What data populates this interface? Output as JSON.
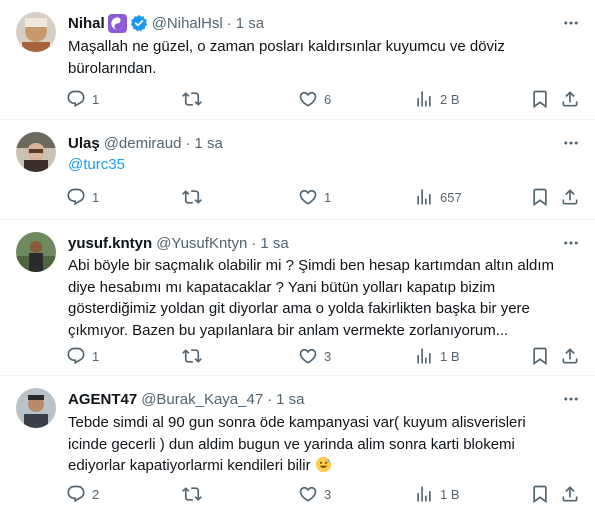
{
  "tweets": [
    {
      "name": "Nihal",
      "handle": "@NihalHsl",
      "sep": "·",
      "time": "1 sa",
      "text": "Maşallah ne güzel, o zaman posları kaldırsınlar kuyumcu ve döviz\nbürolarından.",
      "replies": "1",
      "retweets": "",
      "likes": "6",
      "views": "2 B",
      "badges": [
        "yin-yang-icon",
        "verified-badge-icon"
      ]
    },
    {
      "name": "Ulaş",
      "handle": "@demiraud",
      "sep": "·",
      "time": "1 sa",
      "text": "@turc35",
      "replies": "1",
      "retweets": "",
      "likes": "1",
      "views": "657",
      "badges": []
    },
    {
      "name": "yusuf.kntyn",
      "handle": "@YusufKntyn",
      "sep": "·",
      "time": "1 sa",
      "text": "Abi böyle bir saçmalık olabilir mi ? Şimdi ben hesap kartımdan altın aldım\ndiye hesabımı mı kapatacaklar ? Yani bütün yolları kapatıp bizim\ngösterdiğimiz yoldan git diyorlar ama o yolda fakirlikten başka bir yere\nçıkmıyor. Bazen bu yapılanlara bir anlam vermekte zorlanıyorum...",
      "replies": "1",
      "retweets": "",
      "likes": "3",
      "views": "1 B",
      "badges": []
    },
    {
      "name": "AGENT47",
      "handle": "@Burak_Kaya_47",
      "sep": "·",
      "time": "1 sa",
      "text": "Tebde simdi al 90 gun sonra öde kampanyasi var( kuyum alisverisleri\nicinde gecerli ) dun  aldim bugun ve yarinda alim sonra karti blokemi\nediyorlar kapatiyorlarmi kendileri bilir",
      "replies": "2",
      "retweets": "",
      "likes": "3",
      "views": "1 B",
      "badges": []
    }
  ],
  "colors": {
    "text": "#0f1419",
    "secondary": "#536471",
    "link": "#1d9bf0",
    "verified": "#1d9bf0",
    "divider": "#eff3f4"
  },
  "icons": [
    "reply-icon",
    "retweet-icon",
    "like-icon",
    "views-icon",
    "bookmark-icon",
    "share-icon",
    "more-icon",
    "grinning-sweat-emoji"
  ]
}
